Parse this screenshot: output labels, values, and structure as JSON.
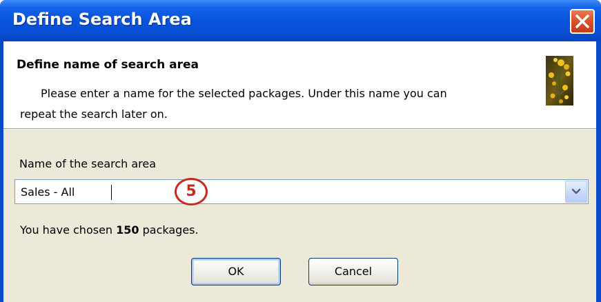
{
  "window": {
    "title": "Define Search Area",
    "close_icon": "close-x-icon"
  },
  "header": {
    "title": "Define name of search area",
    "description_line1": "Please enter a name for the selected packages. Under this name you can",
    "description_line2": "repeat the search later on.",
    "image_icon": "wizard-plant-image"
  },
  "form": {
    "field_label": "Name of the search area",
    "field_value": "Sales - All",
    "dropdown_icon": "chevron-down-icon"
  },
  "callout": {
    "number": "5"
  },
  "status": {
    "prefix": "You have chosen ",
    "count": "150",
    "suffix": " packages."
  },
  "buttons": {
    "ok_label": "OK",
    "cancel_label": "Cancel"
  },
  "colors": {
    "titlebar": "#0a55dd",
    "close_button": "#d9542e",
    "dialog_background": "#ece9d8",
    "callout": "#c8281e"
  }
}
